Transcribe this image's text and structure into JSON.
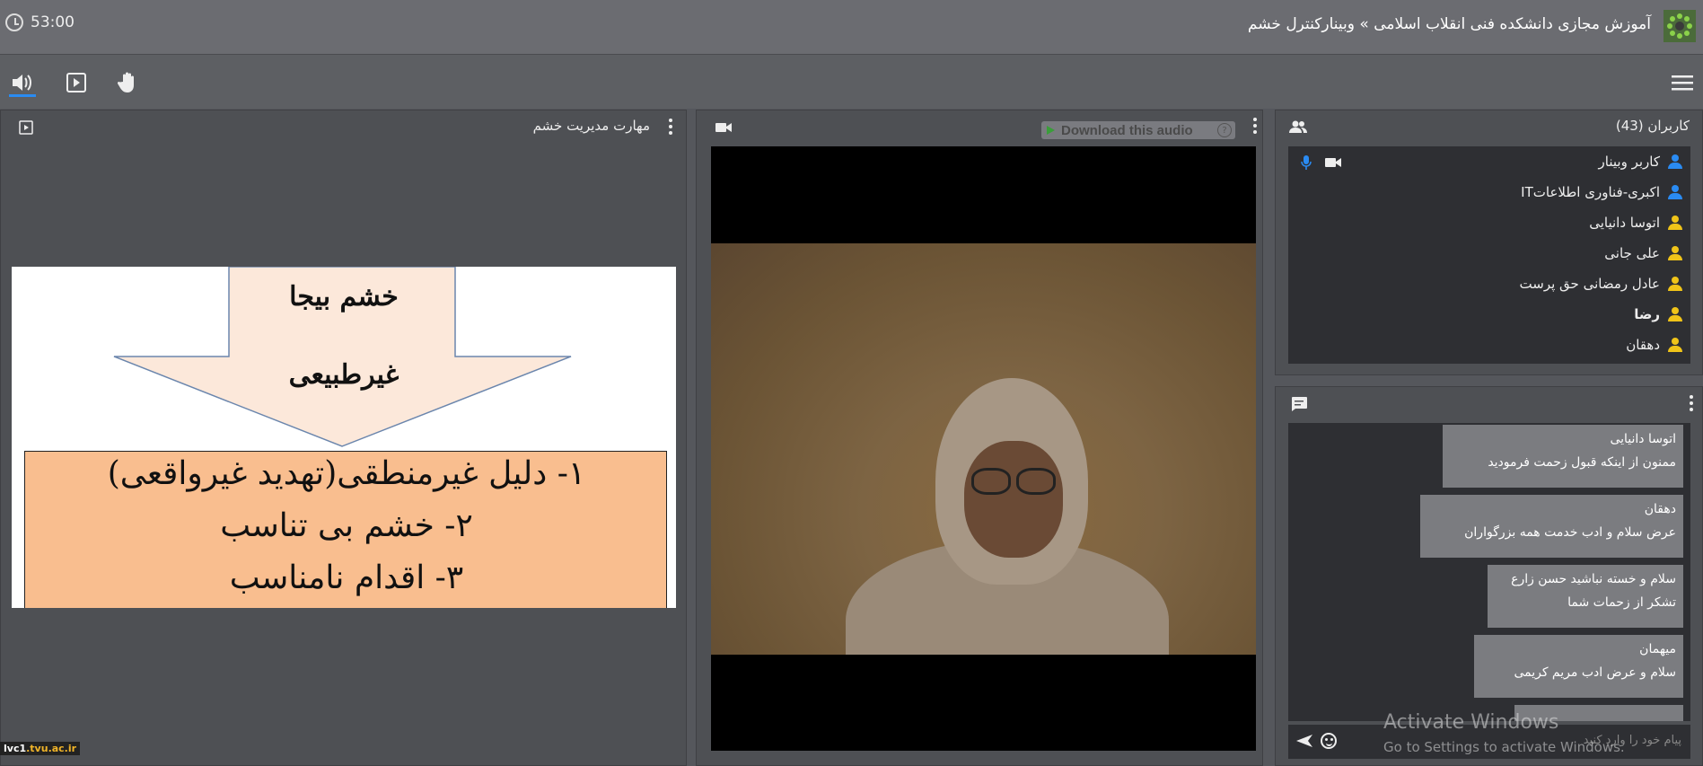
{
  "header": {
    "timer": "53:00",
    "title": "آموزش مجازی دانشکده فنی انقلاب اسلامی » وبینارکنترل خشم"
  },
  "toolbar": {
    "icons": [
      "speaker-icon",
      "play-screen-icon",
      "raise-hand-icon",
      "menu-icon"
    ]
  },
  "presentation": {
    "title": "مهارت مدیریت خشم",
    "slide": {
      "arrow_line1": "خشم بیجا",
      "arrow_line2": "غیرطبیعی",
      "items": [
        "۱- دلیل غیرمنطقی(تهدید غیرواقعی)",
        "۲- خشم بی تناسب",
        "۳- اقدام نامناسب"
      ]
    },
    "status_tag_prefix": "lvc1",
    "status_tag_suffix": ".tvu.ac.ir"
  },
  "video": {
    "download_label": "Download this audio",
    "help": "?"
  },
  "users": {
    "title": "کاربران (43)",
    "list": [
      {
        "name": "کاربر وبینار",
        "color": "#2a8bf2",
        "bold": false
      },
      {
        "name": "اکبری-فناوری اطلاعاتIT",
        "color": "#2a8bf2",
        "bold": false
      },
      {
        "name": "اتوسا دانیایی",
        "color": "#f0c419",
        "bold": false
      },
      {
        "name": "علی جانی",
        "color": "#f0c419",
        "bold": false
      },
      {
        "name": "عادل رمضانی حق پرست",
        "color": "#f0c419",
        "bold": false
      },
      {
        "name": "رضا",
        "color": "#f0c419",
        "bold": true
      },
      {
        "name": "دهقان",
        "color": "#f0c419",
        "bold": false
      }
    ]
  },
  "chat": {
    "messages": [
      {
        "name": "اتوسا دانیایی",
        "text": "ممنون از اینکه قبول زحمت فرمودید"
      },
      {
        "name": "دهقان",
        "text": "عرض سلام و ادب خدمت همه بزرگواران"
      },
      {
        "name": "سلام و خسته نباشید حسن زارع",
        "text": "تشکر از زحمات شما"
      },
      {
        "name": "میهمان",
        "text": "سلام و عرض ادب مریم کریمی"
      }
    ],
    "placeholder": "پیام خود را وارد کنید"
  },
  "watermark": {
    "line1": "Activate Windows",
    "line2": "Go to Settings to activate Windows."
  }
}
